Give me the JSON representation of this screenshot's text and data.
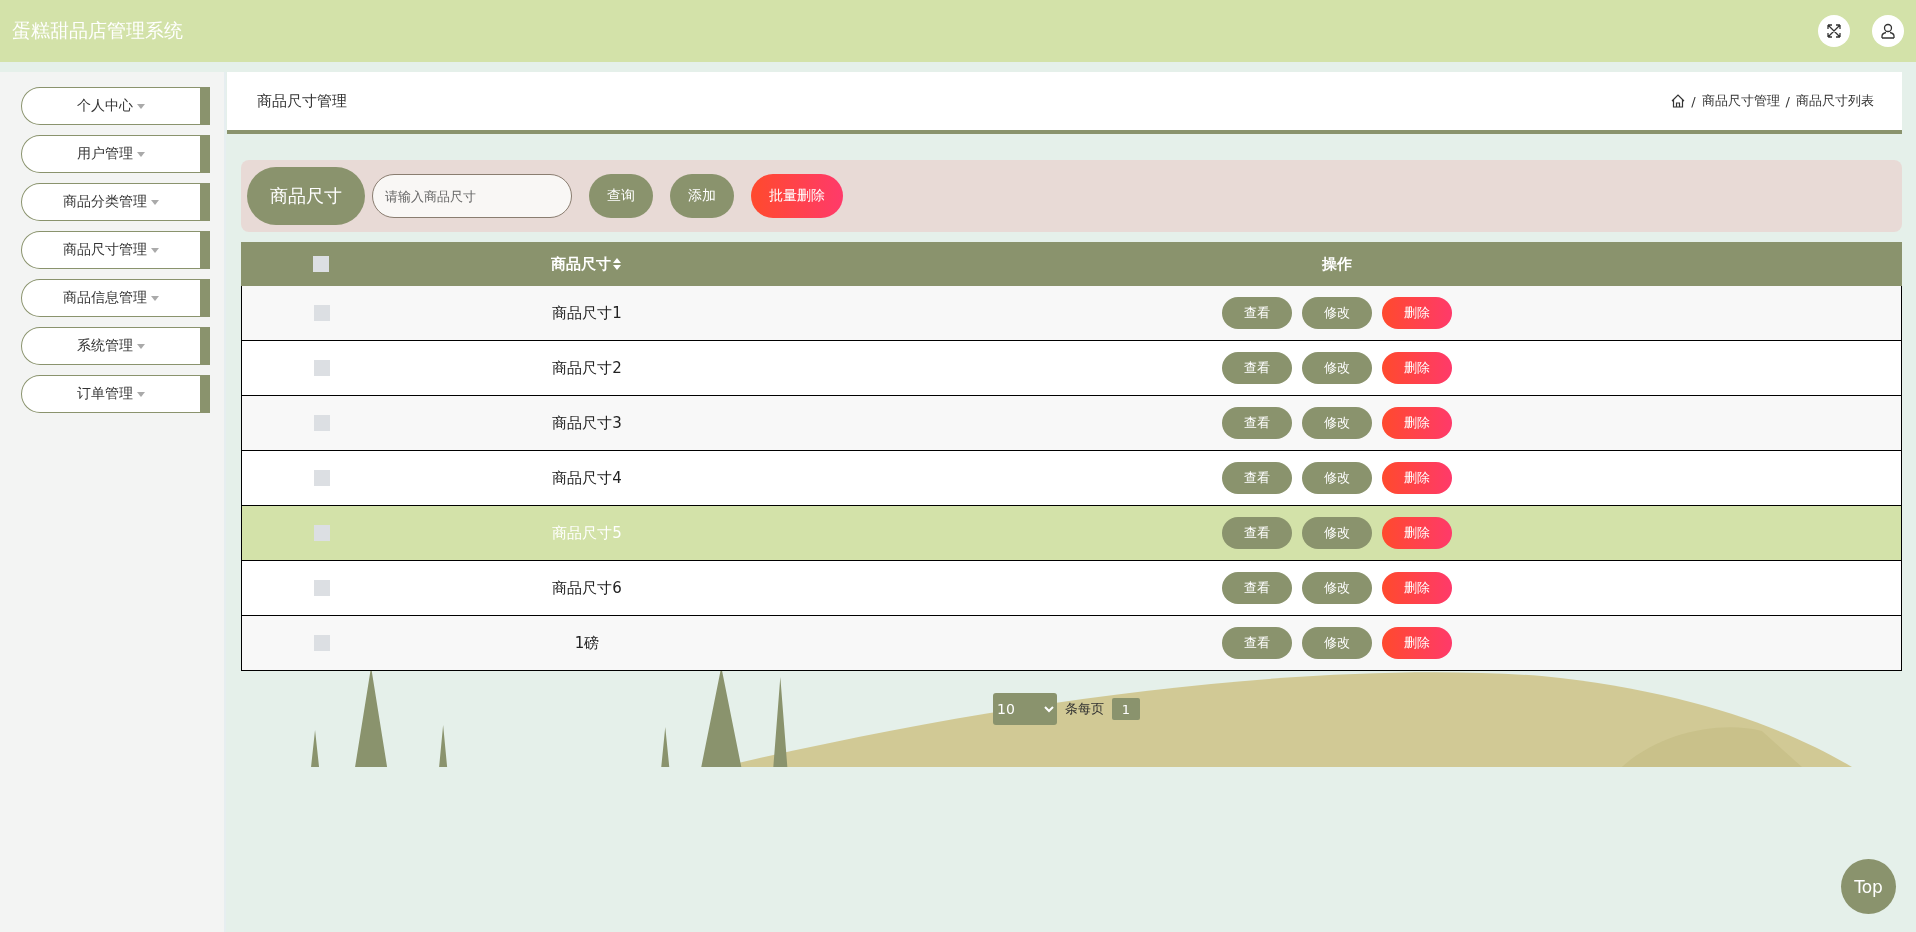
{
  "header": {
    "title": "蛋糕甜品店管理系统"
  },
  "sidebar": {
    "items": [
      {
        "label": "个人中心"
      },
      {
        "label": "用户管理"
      },
      {
        "label": "商品分类管理"
      },
      {
        "label": "商品尺寸管理"
      },
      {
        "label": "商品信息管理"
      },
      {
        "label": "系统管理"
      },
      {
        "label": "订单管理"
      }
    ]
  },
  "page_title": "商品尺寸管理",
  "breadcrumb": [
    {
      "separator": "/",
      "label": "商品尺寸管理"
    },
    {
      "separator": "/",
      "label": "商品尺寸列表"
    }
  ],
  "search": {
    "label": "商品尺寸",
    "placeholder": "请输入商品尺寸",
    "buttons": [
      {
        "label": "查询",
        "kind": "normal"
      },
      {
        "label": "添加",
        "kind": "normal"
      },
      {
        "label": "批量删除",
        "kind": "danger"
      }
    ]
  },
  "table": {
    "select_all_checked": false,
    "columns": [
      "商品尺寸",
      "操作"
    ],
    "rows": [
      {
        "checked": false,
        "highlighted": false,
        "name": "商品尺寸1",
        "actions": [
          {
            "label": "查看",
            "kind": "normal"
          },
          {
            "label": "修改",
            "kind": "normal"
          },
          {
            "label": "删除",
            "kind": "danger"
          }
        ]
      },
      {
        "checked": false,
        "highlighted": false,
        "name": "商品尺寸2",
        "actions": [
          {
            "label": "查看",
            "kind": "normal"
          },
          {
            "label": "修改",
            "kind": "normal"
          },
          {
            "label": "删除",
            "kind": "danger"
          }
        ]
      },
      {
        "checked": false,
        "highlighted": false,
        "name": "商品尺寸3",
        "actions": [
          {
            "label": "查看",
            "kind": "normal"
          },
          {
            "label": "修改",
            "kind": "normal"
          },
          {
            "label": "删除",
            "kind": "danger"
          }
        ]
      },
      {
        "checked": false,
        "highlighted": false,
        "name": "商品尺寸4",
        "actions": [
          {
            "label": "查看",
            "kind": "normal"
          },
          {
            "label": "修改",
            "kind": "normal"
          },
          {
            "label": "删除",
            "kind": "danger"
          }
        ]
      },
      {
        "checked": false,
        "highlighted": true,
        "name": "商品尺寸5",
        "actions": [
          {
            "label": "查看",
            "kind": "normal"
          },
          {
            "label": "修改",
            "kind": "normal"
          },
          {
            "label": "删除",
            "kind": "danger"
          }
        ]
      },
      {
        "checked": false,
        "highlighted": false,
        "name": "商品尺寸6",
        "actions": [
          {
            "label": "查看",
            "kind": "normal"
          },
          {
            "label": "修改",
            "kind": "normal"
          },
          {
            "label": "删除",
            "kind": "danger"
          }
        ]
      },
      {
        "checked": false,
        "highlighted": false,
        "name": "1磅",
        "actions": [
          {
            "label": "查看",
            "kind": "normal"
          },
          {
            "label": "修改",
            "kind": "normal"
          },
          {
            "label": "删除",
            "kind": "danger"
          }
        ]
      }
    ]
  },
  "pagination": {
    "page_size": "10",
    "per_page_label": "条每页",
    "pages": [
      {
        "label": "1",
        "selected": true
      }
    ]
  },
  "top_button": "Top"
}
